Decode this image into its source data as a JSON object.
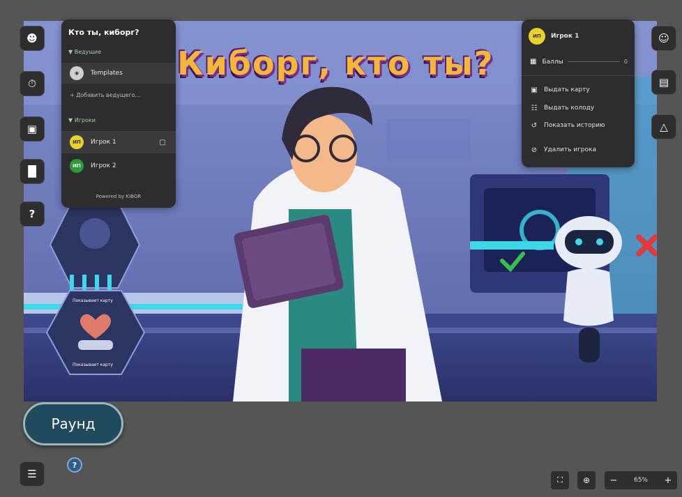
{
  "game": {
    "title": "Кто ты, киборг?",
    "banner_text": "Киборг, кто ты?"
  },
  "left_panel": {
    "hosts_section": "Ведущие",
    "host_name": "Templates",
    "add_host": "+ Добавить ведущего...",
    "players_section": "Игроки",
    "players": [
      {
        "initials": "ИП",
        "name": "Игрок 1",
        "color": "#e8d12a"
      },
      {
        "initials": "ИП",
        "name": "Игрок 2",
        "color": "#2e9b3a"
      }
    ],
    "footer": "Powered by KIBOR"
  },
  "right_panel": {
    "player_initials": "ИП",
    "player_name": "Игрок 1",
    "score_label": "Баллы",
    "score_value": "0",
    "menu": [
      {
        "icon": "card-icon",
        "label": "Выдать карту"
      },
      {
        "icon": "deck-icon",
        "label": "Выдать колоду"
      },
      {
        "icon": "history-icon",
        "label": "Показать историю"
      },
      {
        "icon": "remove-icon",
        "label": "Удалить игрока"
      }
    ]
  },
  "hex_cards": [
    {
      "label": "Показывает карту"
    },
    {
      "label": "Показывает карту"
    }
  ],
  "round_button": "Раунд",
  "help_glyph": "?",
  "zoom": {
    "value": "65%",
    "minus": "−",
    "plus": "+"
  },
  "colors": {
    "player1": "#e8d12a",
    "player2": "#2e9b3a",
    "round_button": "#1f4b5c",
    "accent_green": "#36c24a"
  }
}
